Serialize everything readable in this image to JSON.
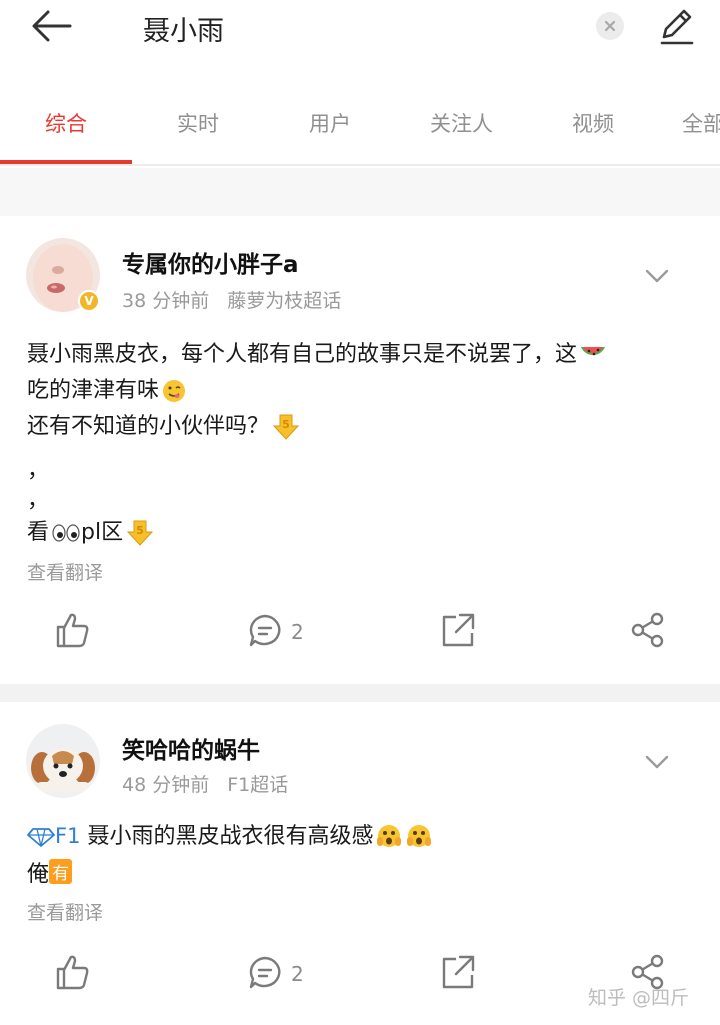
{
  "header": {
    "search_query": "聂小雨"
  },
  "tabs": [
    {
      "label": "综合",
      "active": true
    },
    {
      "label": "实时",
      "active": false
    },
    {
      "label": "用户",
      "active": false
    },
    {
      "label": "关注人",
      "active": false
    },
    {
      "label": "视频",
      "active": false
    },
    {
      "label": "全部",
      "active": false
    }
  ],
  "posts": [
    {
      "username": "专属你的小胖子a",
      "time": "38 分钟前",
      "source": "藤萝为枝超话",
      "verified": true,
      "lines": [
        "聂小雨黑皮衣，每个人都有自己的故事只是不说罢了，这",
        "吃的津津有味",
        "还有不知道的小伙伴吗？",
        "，",
        "，",
        "看",
        "pl区"
      ],
      "translate_label": "查看翻译",
      "comments": "2"
    },
    {
      "username": "笑哈哈的蜗牛",
      "time": "48 分钟前",
      "source": "F1超话",
      "badge": "F1",
      "lines": [
        "聂小雨的黑皮战衣很有高级感",
        "俺",
        "有"
      ],
      "translate_label": "查看翻译",
      "comments": "2"
    }
  ],
  "watermark": "知乎 @四斤",
  "colors": {
    "accent": "#e8392f",
    "meta": "#9a9a9a",
    "f1_badge": "#2f7fd6",
    "tag_orange": "#ff9d1c"
  }
}
